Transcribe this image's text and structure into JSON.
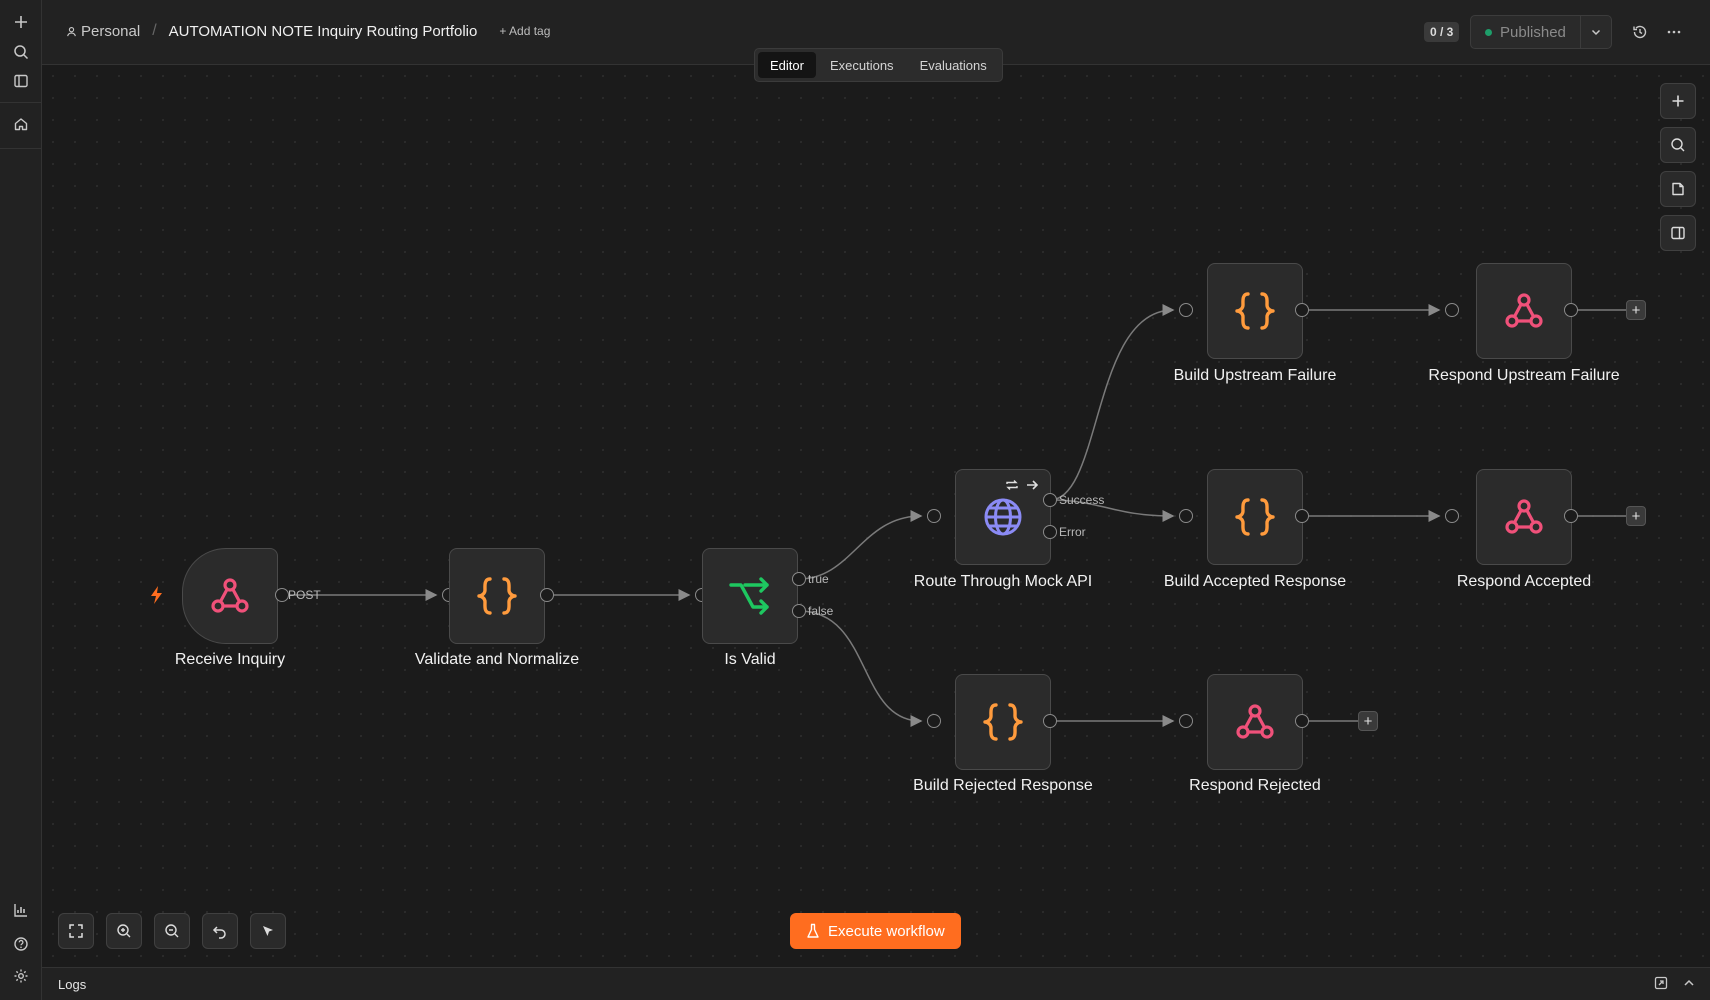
{
  "header": {
    "project": "Personal",
    "title": "AUTOMATION NOTE Inquiry Routing Portfolio",
    "add_tag": "+ Add tag",
    "counter": "0 / 3",
    "publish_label": "Published"
  },
  "tabs": [
    {
      "label": "Editor",
      "active": true
    },
    {
      "label": "Executions",
      "active": false
    },
    {
      "label": "Evaluations",
      "active": false
    }
  ],
  "nodes": {
    "receive_inquiry": "Receive Inquiry",
    "validate_normalize": "Validate and Normalize",
    "is_valid": "Is Valid",
    "route_mock_api": "Route Through Mock API",
    "build_upstream_failure": "Build Upstream Failure",
    "respond_upstream_failure": "Respond Upstream Failure",
    "build_accepted": "Build Accepted Response",
    "respond_accepted": "Respond Accepted",
    "build_rejected": "Build Rejected Response",
    "respond_rejected": "Respond Rejected"
  },
  "handle_labels": {
    "post": "POST",
    "true": "true",
    "false": "false",
    "success": "Success",
    "error": "Error"
  },
  "actions": {
    "execute": "Execute workflow"
  },
  "logs": {
    "label": "Logs"
  },
  "colors": {
    "accent": "#ff6d1f",
    "webhook": "#f0517a",
    "code": "#ff9b3d",
    "if": "#1ec760",
    "http": "#8b8bf5",
    "published_dot": "#1e9e6a"
  }
}
